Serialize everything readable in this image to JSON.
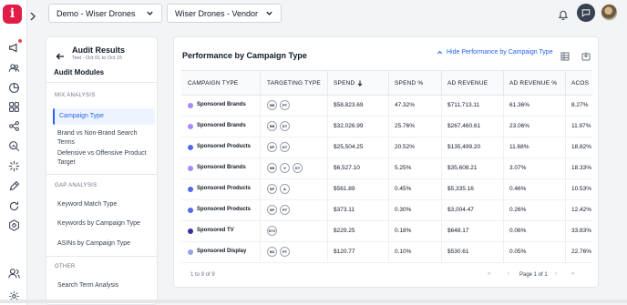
{
  "app": {
    "logo_letter": "i",
    "brand_color": "#e11d48"
  },
  "rail": {
    "icons": [
      "megaphone-icon",
      "users-icon",
      "chart-pie-icon",
      "grid-icon",
      "share-icon",
      "search-analytics-icon",
      "sparkle-icon",
      "pen-icon",
      "refresh-icon",
      "settings-gear-icon",
      "profile-icon",
      "settings-icon"
    ]
  },
  "topbar": {
    "account_select": "Demo - Wiser Drones",
    "profile_select": "Wiser Drones - Vendor"
  },
  "panel": {
    "title": "Audit Results",
    "subtitle": "Test - Oct 01 to Oct 15",
    "modules_heading": "Audit Modules",
    "groups": [
      {
        "label": "MIX ANALYSIS",
        "items": [
          "Campaign Type",
          "Brand vs Non-Brand Search Terms",
          "Defensive vs Offensive Product Target"
        ]
      },
      {
        "label": "GAP ANALYSIS",
        "items": [
          "Keyword Match Type",
          "Keywords by Campaign Type",
          "ASINs by Campaign Type"
        ]
      },
      {
        "label": "OTHER",
        "items": [
          "Search Term Analysis"
        ]
      }
    ],
    "active_item": "Campaign Type"
  },
  "card": {
    "title": "Performance by Campaign Type",
    "hide_link": "Hide Performance by Campaign Type",
    "columns": [
      "CAMPAIGN TYPE",
      "TARGETING TYPE",
      "SPEND",
      "SPEND %",
      "AD REVENUE",
      "AD REVENUE %",
      "ACOS"
    ],
    "rows": [
      {
        "type": "Sponsored Brands",
        "color": "#a78bfa",
        "targeting": [
          "SB",
          "PT"
        ],
        "spend": "$58,823.69",
        "spend_pct": "47.32%",
        "revenue": "$711,713.11",
        "revenue_pct": "61.36%",
        "acos": "8.27%"
      },
      {
        "type": "Sponsored Brands",
        "color": "#a78bfa",
        "targeting": [
          "SB",
          "KT"
        ],
        "spend": "$32,026.99",
        "spend_pct": "25.76%",
        "revenue": "$267,460.61",
        "revenue_pct": "23.06%",
        "acos": "11.97%"
      },
      {
        "type": "Sponsored Products",
        "color": "#4f6bed",
        "targeting": [
          "SP",
          "KT"
        ],
        "spend": "$25,504.25",
        "spend_pct": "20.52%",
        "revenue": "$135,499.20",
        "revenue_pct": "11.68%",
        "acos": "18.82%"
      },
      {
        "type": "Sponsored Brands",
        "color": "#a78bfa",
        "targeting": [
          "SB",
          "V",
          "KT"
        ],
        "spend": "$6,527.10",
        "spend_pct": "5.25%",
        "revenue": "$35,608.21",
        "revenue_pct": "3.07%",
        "acos": "18.33%"
      },
      {
        "type": "Sponsored Products",
        "color": "#4f6bed",
        "targeting": [
          "SP",
          "A"
        ],
        "spend": "$561.89",
        "spend_pct": "0.45%",
        "revenue": "$5,335.16",
        "revenue_pct": "0.46%",
        "acos": "10.53%"
      },
      {
        "type": "Sponsored Products",
        "color": "#4f6bed",
        "targeting": [
          "SP",
          "PT"
        ],
        "spend": "$373.11",
        "spend_pct": "0.30%",
        "revenue": "$3,004.47",
        "revenue_pct": "0.26%",
        "acos": "12.42%"
      },
      {
        "type": "Sponsored TV",
        "color": "#3730a3",
        "targeting": [
          "STV"
        ],
        "spend": "$229.25",
        "spend_pct": "0.18%",
        "revenue": "$648.17",
        "revenue_pct": "0.06%",
        "acos": "33.83%"
      },
      {
        "type": "Sponsored Display",
        "color": "#93a5e8",
        "targeting": [
          "SD",
          "PT"
        ],
        "spend": "$120.77",
        "spend_pct": "0.10%",
        "revenue": "$530.61",
        "revenue_pct": "0.05%",
        "acos": "22.76%"
      }
    ],
    "footer_count": "1 to 9 of 9",
    "pager_text": "Page 1 of 1"
  }
}
